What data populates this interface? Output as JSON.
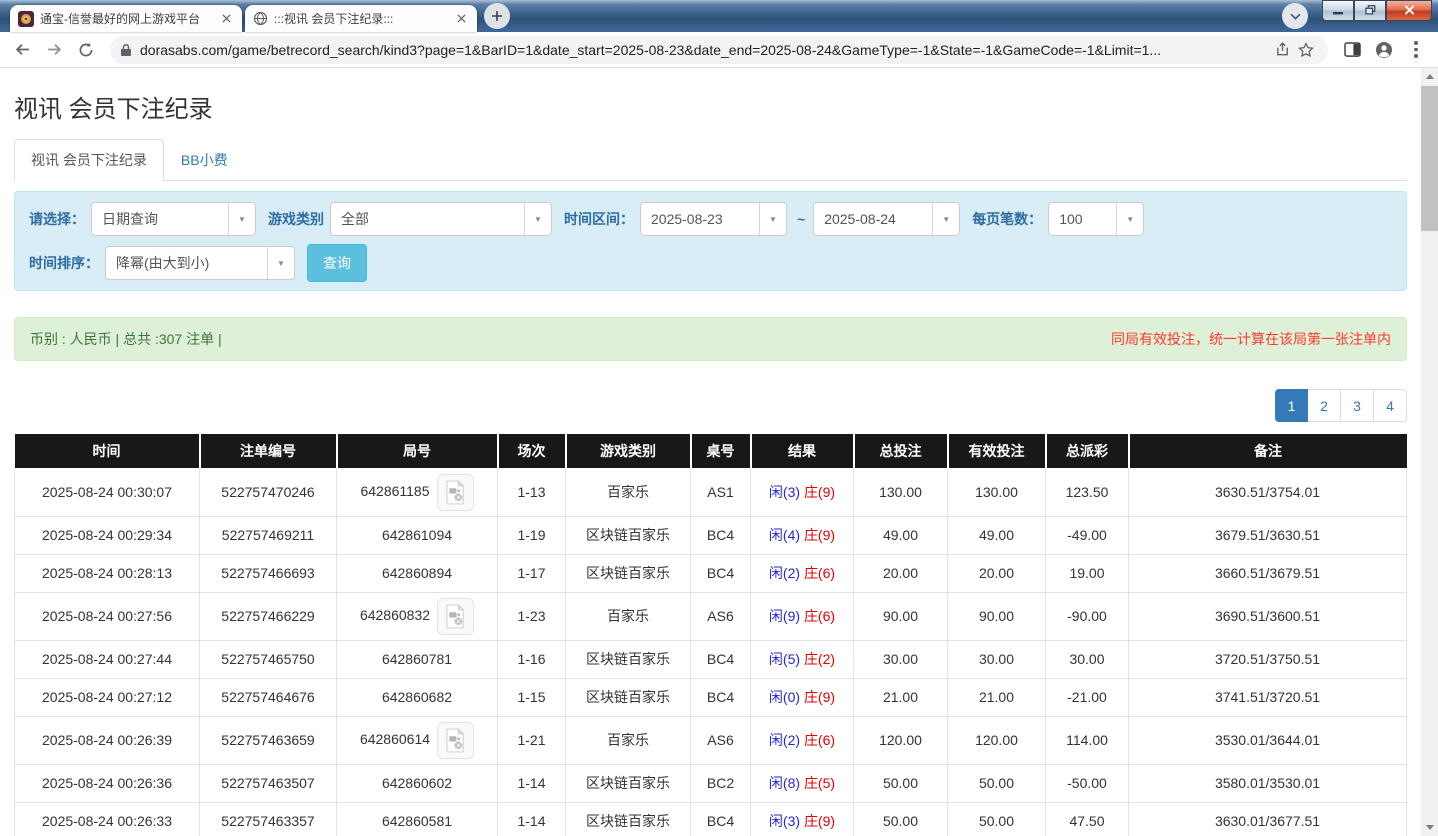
{
  "browser": {
    "tab1": {
      "title": "通宝-信誉最好的网上游戏平台"
    },
    "tab2": {
      "title": ":::视讯 会员下注纪录:::"
    },
    "url": "dorasabs.com/game/betrecord_search/kind3?page=1&BarID=1&date_start=2025-08-23&date_end=2025-08-24&GameType=-1&State=-1&GameCode=-1&Limit=1..."
  },
  "icons": {
    "navigation": [
      "back-arrow-icon",
      "forward-arrow-icon",
      "reload-icon"
    ],
    "omnibox": [
      "lock-icon",
      "share-icon",
      "star-icon"
    ],
    "toolbar_right": [
      "side-panel-icon",
      "avatar-icon",
      "kebab-menu-icon"
    ],
    "titlebar": [
      "site-favicon",
      "globe-icon",
      "close-icon",
      "plus-icon",
      "chevron-down-icon",
      "minimize-icon",
      "restore-icon"
    ],
    "table": [
      "video-replay-icon"
    ],
    "selects": [
      "caret-down-icon"
    ]
  },
  "colors": {
    "accent_blue": "#337ab7",
    "value_blue": "#2e7be0",
    "negative_red": "#ff0000",
    "result_player_blue": "#2626d9",
    "result_banker_red": "#e60000",
    "header_bg": "#181818",
    "panel_bg": "#d9edf7",
    "summary_bg": "#dff0d8",
    "summary_text": "#3c763d",
    "warning_red": "#fd3a2d",
    "button_cyan": "#5bc0de"
  },
  "page": {
    "title": "视讯 会员下注纪录",
    "nav_tabs": {
      "active": "视讯 会员下注纪录",
      "inactive": "BB小费"
    },
    "filters": {
      "select_label": "请选择：",
      "select_value": "日期查询",
      "game_type_label": "游戏类别",
      "game_type_value": "全部",
      "range_label": "时间区间：",
      "date_start": "2025-08-23",
      "range_separator": "~",
      "date_end": "2025-08-24",
      "page_size_label": "每页笔数：",
      "page_size_value": "100",
      "sort_label": "时间排序：",
      "sort_value": "降幂(由大到小)",
      "search_button": "查询"
    },
    "summary": {
      "left": "币别 : 人民币 | 总共 :307 注单 |",
      "right": "同局有效投注，统一计算在该局第一张注单内"
    },
    "pagination": {
      "pages": [
        "1",
        "2",
        "3",
        "4"
      ],
      "active_index": 0
    },
    "table": {
      "headers": [
        "时间",
        "注单编号",
        "局号",
        "场次",
        "游戏类别",
        "桌号",
        "结果",
        "总投注",
        "有效投注",
        "总派彩",
        "备注"
      ],
      "rows": [
        {
          "time": "2025-08-24 00:30:07",
          "bet_id": "522757470246",
          "round_id": "642861185",
          "has_video": true,
          "session": "1-13",
          "game": "百家乐",
          "table": "AS1",
          "result_player": "闲(3)",
          "result_banker": "庄(9)",
          "total_bet": "130.00",
          "valid_bet": "130.00",
          "payout": "123.50",
          "note": "3630.51/3754.01"
        },
        {
          "time": "2025-08-24 00:29:34",
          "bet_id": "522757469211",
          "round_id": "642861094",
          "has_video": false,
          "session": "1-19",
          "game": "区块链百家乐",
          "table": "BC4",
          "result_player": "闲(4)",
          "result_banker": "庄(9)",
          "total_bet": "49.00",
          "valid_bet": "49.00",
          "payout": "-49.00",
          "note": "3679.51/3630.51"
        },
        {
          "time": "2025-08-24 00:28:13",
          "bet_id": "522757466693",
          "round_id": "642860894",
          "has_video": false,
          "session": "1-17",
          "game": "区块链百家乐",
          "table": "BC4",
          "result_player": "闲(2)",
          "result_banker": "庄(6)",
          "total_bet": "20.00",
          "valid_bet": "20.00",
          "payout": "19.00",
          "note": "3660.51/3679.51"
        },
        {
          "time": "2025-08-24 00:27:56",
          "bet_id": "522757466229",
          "round_id": "642860832",
          "has_video": true,
          "session": "1-23",
          "game": "百家乐",
          "table": "AS6",
          "result_player": "闲(9)",
          "result_banker": "庄(6)",
          "total_bet": "90.00",
          "valid_bet": "90.00",
          "payout": "-90.00",
          "note": "3690.51/3600.51"
        },
        {
          "time": "2025-08-24 00:27:44",
          "bet_id": "522757465750",
          "round_id": "642860781",
          "has_video": false,
          "session": "1-16",
          "game": "区块链百家乐",
          "table": "BC4",
          "result_player": "闲(5)",
          "result_banker": "庄(2)",
          "total_bet": "30.00",
          "valid_bet": "30.00",
          "payout": "30.00",
          "note": "3720.51/3750.51"
        },
        {
          "time": "2025-08-24 00:27:12",
          "bet_id": "522757464676",
          "round_id": "642860682",
          "has_video": false,
          "session": "1-15",
          "game": "区块链百家乐",
          "table": "BC4",
          "result_player": "闲(0)",
          "result_banker": "庄(9)",
          "total_bet": "21.00",
          "valid_bet": "21.00",
          "payout": "-21.00",
          "note": "3741.51/3720.51"
        },
        {
          "time": "2025-08-24 00:26:39",
          "bet_id": "522757463659",
          "round_id": "642860614",
          "has_video": true,
          "session": "1-21",
          "game": "百家乐",
          "table": "AS6",
          "result_player": "闲(2)",
          "result_banker": "庄(6)",
          "total_bet": "120.00",
          "valid_bet": "120.00",
          "payout": "114.00",
          "note": "3530.01/3644.01"
        },
        {
          "time": "2025-08-24 00:26:36",
          "bet_id": "522757463507",
          "round_id": "642860602",
          "has_video": false,
          "session": "1-14",
          "game": "区块链百家乐",
          "table": "BC2",
          "result_player": "闲(8)",
          "result_banker": "庄(5)",
          "total_bet": "50.00",
          "valid_bet": "50.00",
          "payout": "-50.00",
          "note": "3580.01/3530.01"
        },
        {
          "time": "2025-08-24 00:26:33",
          "bet_id": "522757463357",
          "round_id": "642860581",
          "has_video": false,
          "session": "1-14",
          "game": "区块链百家乐",
          "table": "BC4",
          "result_player": "闲(3)",
          "result_banker": "庄(9)",
          "total_bet": "50.00",
          "valid_bet": "50.00",
          "payout": "47.50",
          "note": "3630.01/3677.51"
        }
      ]
    }
  }
}
